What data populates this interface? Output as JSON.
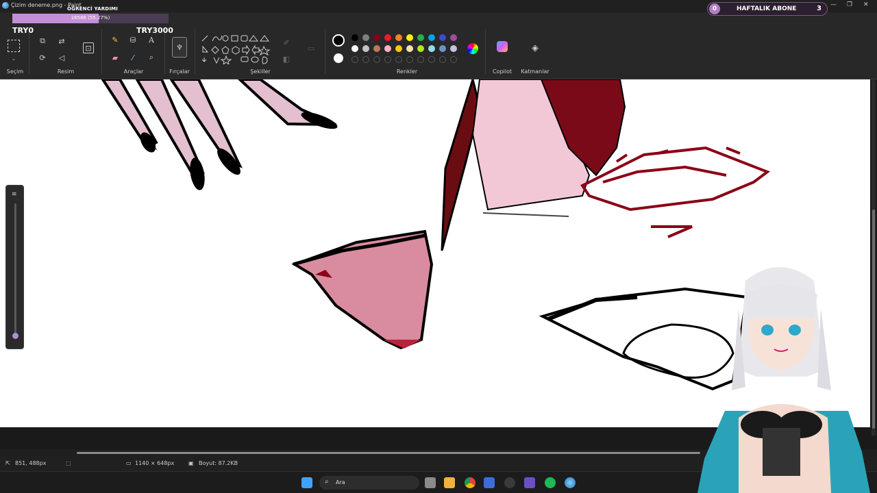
{
  "window": {
    "title": "Çizim deneme.png - Paint"
  },
  "overlay": {
    "label": "ÖĞRENCİ YARDIMI",
    "progress_text": "16586 (55.27%)",
    "progress_fraction": 0.5527,
    "try_left": "TRY0",
    "try_right": "TRY3000"
  },
  "subscribers": {
    "count_left": "0",
    "label": "HAFTALIK ABONE",
    "count_right": "3"
  },
  "ribbon": {
    "groups": {
      "selection": "Seçim",
      "image": "Resim",
      "tools": "Araçlar",
      "brushes": "Fırçalar",
      "shapes": "Şekiller",
      "colors": "Renkler",
      "copilot": "Copilot",
      "layers": "Katmanlar"
    },
    "colors_row1": [
      "#000000",
      "#7f7f7f",
      "#880015",
      "#ed1c24",
      "#ff7f27",
      "#fff200",
      "#22b14c",
      "#00a2e8",
      "#3f48cc",
      "#a349a4"
    ],
    "colors_row2": [
      "#ffffff",
      "#c3c3c3",
      "#b97a57",
      "#ffaec9",
      "#ffc90e",
      "#efe4b0",
      "#b5e61d",
      "#99d9ea",
      "#7092be",
      "#c8bfe7"
    ]
  },
  "status": {
    "cursor": "851, 488px",
    "canvas_size": "1140 × 648px",
    "file_size": "Boyut: 87.2KB"
  },
  "taskbar": {
    "search": "Ara"
  }
}
